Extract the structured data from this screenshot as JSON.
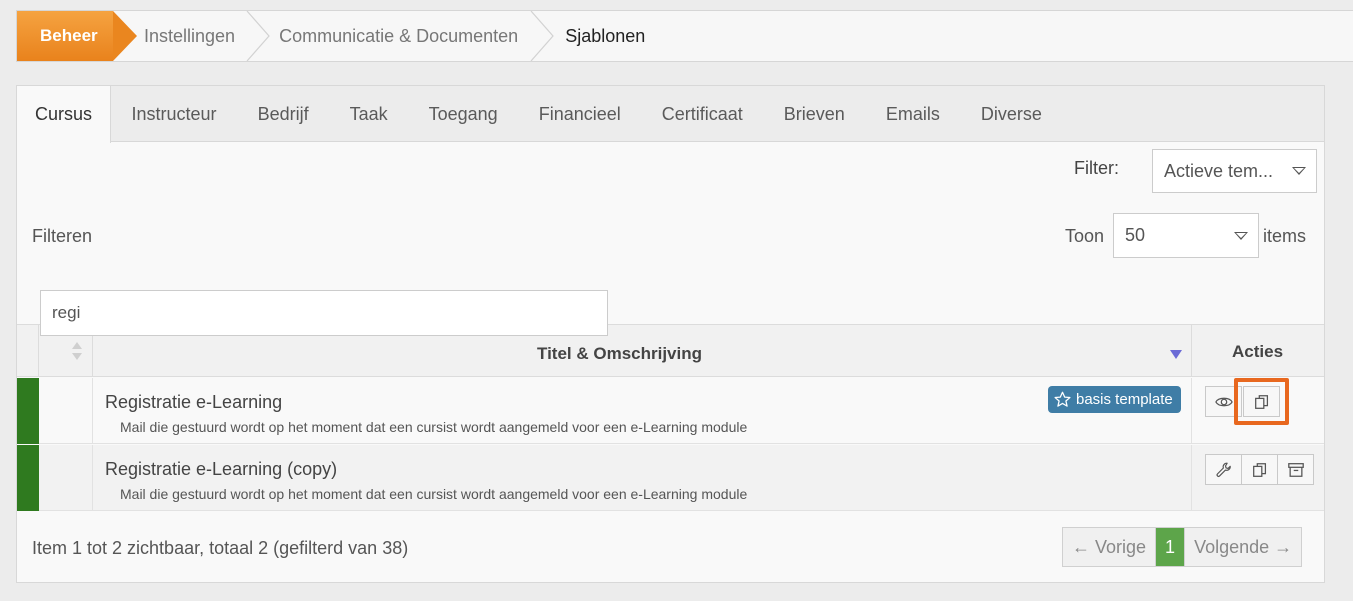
{
  "breadcrumb": {
    "items": [
      "Beheer",
      "Instellingen",
      "Communicatie & Documenten",
      "Sjablonen"
    ]
  },
  "tabs": [
    "Cursus",
    "Instructeur",
    "Bedrijf",
    "Taak",
    "Toegang",
    "Financieel",
    "Certificaat",
    "Brieven",
    "Emails",
    "Diverse"
  ],
  "filter": {
    "label": "Filter:",
    "value": "Actieve tem..."
  },
  "filteren_label": "Filteren",
  "page_size": {
    "before": "Toon",
    "value": "50",
    "after": "items"
  },
  "search": {
    "value": "regi"
  },
  "table": {
    "title_header": "Titel & Omschrijving",
    "actions_header": "Acties",
    "rows": [
      {
        "title": "Registratie e-Learning",
        "description": "Mail die gestuurd wordt op het moment dat een cursist wordt aangemeld voor een e-Learning module",
        "badge": "basis template",
        "actions": [
          "eye-icon",
          "copy-icon"
        ]
      },
      {
        "title": "Registratie e-Learning (copy)",
        "description": "Mail die gestuurd wordt op het moment dat een cursist wordt aangemeld voor een e-Learning module",
        "actions": [
          "wrench-icon",
          "copy-icon",
          "archive-icon"
        ]
      }
    ]
  },
  "footer": {
    "summary": "Item 1 tot 2 zichtbaar, totaal 2 (gefilterd van 38)",
    "prev": "← Vorige",
    "page": "1",
    "next": "Volgende →"
  },
  "colors": {
    "accent": "#e9821c",
    "status_green": "#2f7a1f",
    "badge_blue": "#3f7da6",
    "highlight": "#e8681f"
  }
}
